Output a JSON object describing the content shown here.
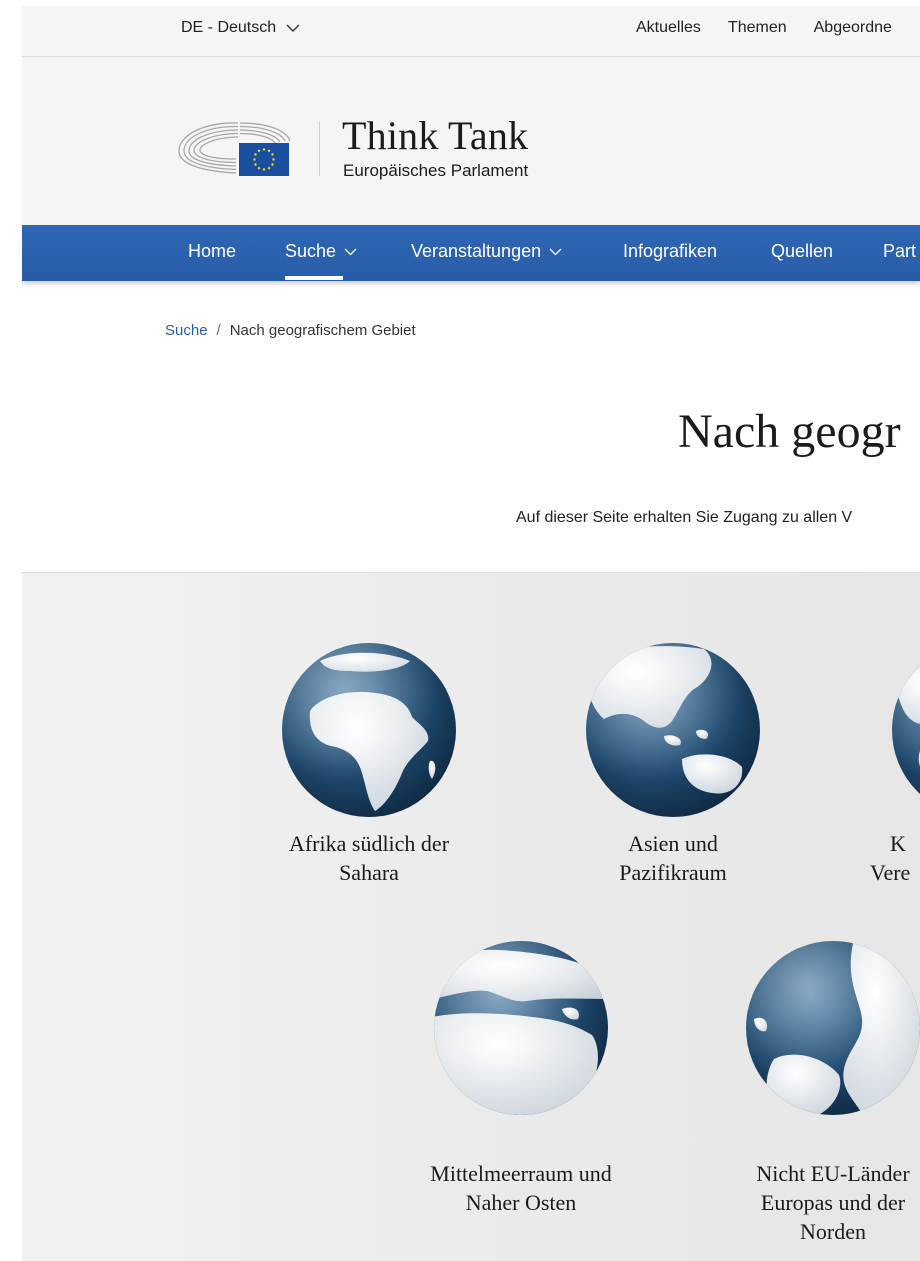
{
  "topbar": {
    "language": "DE - Deutsch",
    "links": [
      "Aktuelles",
      "Themen",
      "Abgeordne"
    ]
  },
  "brand": {
    "title": "Think Tank",
    "subtitle": "Europäisches Parlament"
  },
  "nav": {
    "items": [
      {
        "label": "Home"
      },
      {
        "label": "Suche"
      },
      {
        "label": "Veranstaltungen"
      },
      {
        "label": "Infografiken"
      },
      {
        "label": "Quellen"
      },
      {
        "label": "Part"
      }
    ],
    "active": "Suche"
  },
  "breadcrumb": {
    "link": "Suche",
    "separator": "/",
    "current": "Nach geografischem Gebiet"
  },
  "page": {
    "title": "Nach geogr",
    "intro": "Auf dieser Seite erhalten Sie Zugang zu allen V"
  },
  "regions": [
    {
      "line1": "Afrika südlich der",
      "line2": "Sahara",
      "line3": ""
    },
    {
      "line1": "Asien und",
      "line2": "Pazifikraum",
      "line3": ""
    },
    {
      "line1": "K",
      "line2": "Vere",
      "line3": ""
    },
    {
      "line1": "Mittelmeerraum und",
      "line2": "Naher Osten",
      "line3": ""
    },
    {
      "line1": "Nicht EU-Länder",
      "line2": "Europas und der",
      "line3": "Norden"
    }
  ],
  "colors": {
    "nav_blue": "#2a5faa",
    "link_blue": "#2660ad",
    "eu_blue": "#1a4fa0",
    "eu_gold": "#ffd617",
    "globe_dark": "#1c4566"
  }
}
